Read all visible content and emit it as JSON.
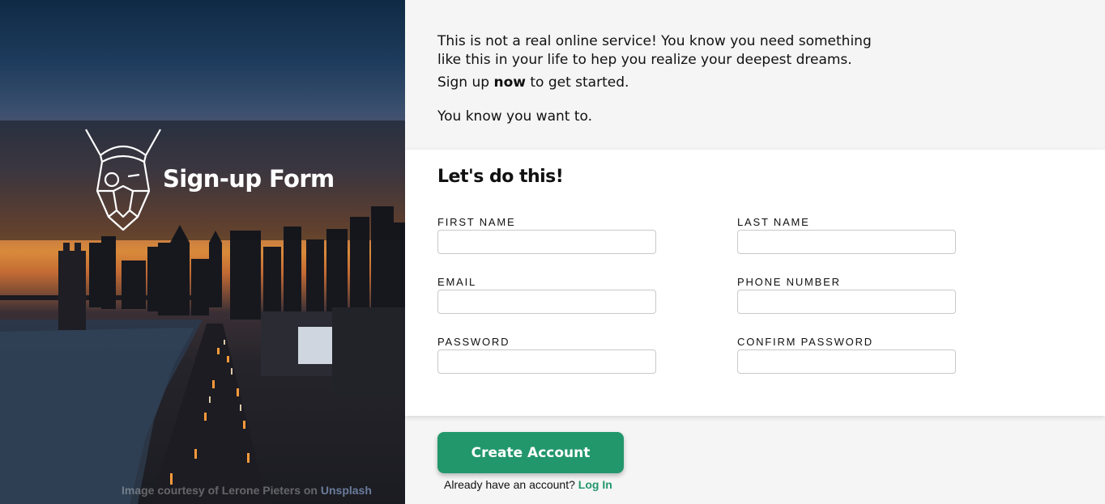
{
  "hero": {
    "title": "Sign-up Form",
    "credit_prefix": "Image courtesy of",
    "credit_author": "Lerone Pieters",
    "credit_on": "on",
    "credit_site": "Unsplash",
    "logo_icon": "viking-helmet-icon"
  },
  "intro": {
    "line1": "This is not a real online service! You know you need something like this in your life to hep you realize your deepest dreams.",
    "line2_before": "Sign up",
    "line2_bold": "now",
    "line2_after": "to get started.",
    "line3": "You know you want to."
  },
  "form": {
    "heading": "Let's do this!",
    "fields": {
      "first_name": {
        "label": "FIRST NAME",
        "value": ""
      },
      "last_name": {
        "label": "LAST NAME",
        "value": ""
      },
      "email": {
        "label": "EMAIL",
        "value": ""
      },
      "phone": {
        "label": "PHONE NUMBER",
        "value": ""
      },
      "password": {
        "label": "PASSWORD",
        "value": ""
      },
      "confirm_password": {
        "label": "CONFIRM PASSWORD",
        "value": ""
      }
    }
  },
  "actions": {
    "create_label": "Create Account",
    "login_prompt": "Already have an account?",
    "login_link": "Log In"
  },
  "colors": {
    "accent": "#23976c",
    "background": "#f5f5f5",
    "card": "#ffffff"
  }
}
